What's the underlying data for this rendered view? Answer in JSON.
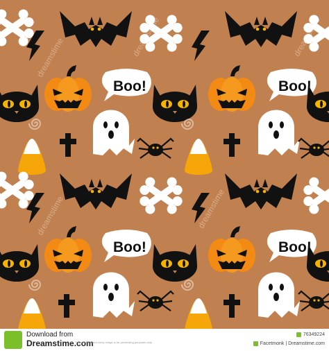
{
  "pattern": {
    "background": "#c0804f",
    "speech_bubble_text": "Boo!",
    "elements": [
      "bat-icon",
      "bone-icon",
      "lightning-icon",
      "cat-icon",
      "pumpkin-icon",
      "ghost-icon",
      "cross-icon",
      "candy-corn-icon",
      "spider-icon",
      "spiral-icon",
      "speech-bubble"
    ],
    "watermark": "dreamstime"
  },
  "footer": {
    "download_from": "Download from",
    "site": "Dreamstime.com",
    "fine_print": "This watermarked comp image is for previewing purposes only.",
    "image_id": "76349224",
    "credit": "Facetmonk | Dreamstime.com"
  }
}
